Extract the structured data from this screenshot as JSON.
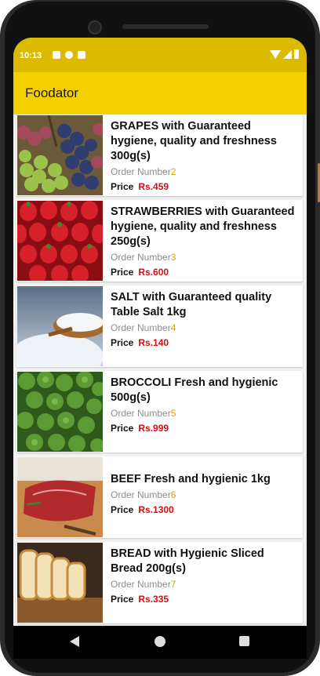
{
  "status_bar": {
    "time": "10:13"
  },
  "app_bar": {
    "title": "Foodator"
  },
  "products": [
    {
      "title": "GRAPES with Guaranteed hygiene, quality and freshness 300g(s)",
      "order_label": "Order Number",
      "order_number": "2",
      "price_label": "Price",
      "price": "Rs.459",
      "image": "grapes"
    },
    {
      "title": "STRAWBERRIES with Guaranteed hygiene, quality and freshness 250g(s)",
      "order_label": "Order Number",
      "order_number": "3",
      "price_label": "Price",
      "price": "Rs.600",
      "image": "strawberries"
    },
    {
      "title": "SALT with Guaranteed quality Table Salt 1kg",
      "order_label": "Order Number",
      "order_number": "4",
      "price_label": "Price",
      "price": "Rs.140",
      "image": "salt"
    },
    {
      "title": "BROCCOLI Fresh and hygienic 500g(s)",
      "order_label": "Order Number",
      "order_number": "5",
      "price_label": "Price",
      "price": "Rs.999",
      "image": "broccoli"
    },
    {
      "title": "BEEF Fresh and hygienic 1kg",
      "order_label": "Order Number",
      "order_number": "6",
      "price_label": "Price",
      "price": "Rs.1300",
      "image": "beef"
    },
    {
      "title": "BREAD with Hygienic Sliced Bread 200g(s)",
      "order_label": "Order Number",
      "order_number": "7",
      "price_label": "Price",
      "price": "Rs.335",
      "image": "bread"
    }
  ],
  "colors": {
    "status_bar": "#dbba00",
    "app_bar": "#f4d000",
    "price": "#d01010",
    "order_number": "#d4a300"
  },
  "nav_icons": [
    "back-icon",
    "home-icon",
    "recents-icon"
  ]
}
